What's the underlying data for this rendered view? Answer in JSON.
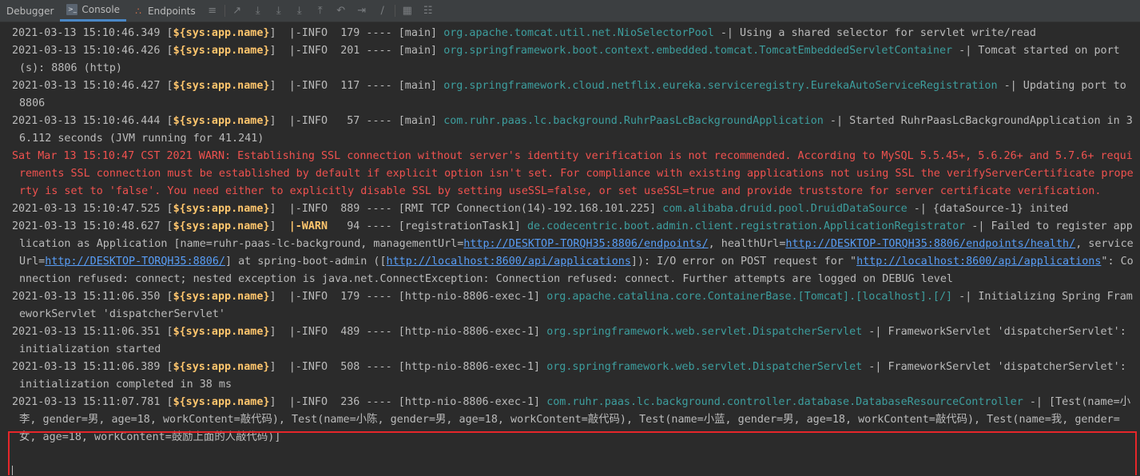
{
  "toolbar": {
    "tabs": [
      {
        "label": "Debugger"
      },
      {
        "label": "Console"
      },
      {
        "label": "Endpoints"
      }
    ]
  },
  "log": {
    "app_token": "${sys:app.name}",
    "lines": [
      {
        "ts": "2021-03-13 15:10:46.349",
        "level": "|-INFO ",
        "thread_id": "179",
        "thread": "[main]",
        "logger": "org.apache.tomcat.util.net.NioSelectorPool",
        "msg": "Using a shared selector for servlet write/read"
      },
      {
        "ts": "2021-03-13 15:10:46.426",
        "level": "|-INFO ",
        "thread_id": "201",
        "thread": "[main]",
        "logger": "org.springframework.boot.context.embedded.tomcat.TomcatEmbeddedServletContainer",
        "msg": "Tomcat started on port(s): 8806 (http)"
      },
      {
        "ts": "2021-03-13 15:10:46.427",
        "level": "|-INFO ",
        "thread_id": "117",
        "thread": "[main]",
        "logger": "org.springframework.cloud.netflix.eureka.serviceregistry.EurekaAutoServiceRegistration",
        "msg": "Updating port to 8806"
      },
      {
        "ts": "2021-03-13 15:10:46.444",
        "level": "|-INFO ",
        "thread_id": " 57",
        "thread": "[main]",
        "logger": "com.ruhr.paas.lc.background.RuhrPaasLcBackgroundApplication",
        "msg": "Started RuhrPaasLcBackgroundApplication in 36.112 seconds (JVM running for 41.241)"
      },
      {
        "ts": "2021-03-13 15:10:47.525",
        "level": "|-INFO ",
        "thread_id": "889",
        "thread": "[RMI TCP Connection(14)-192.168.101.225]",
        "logger": "com.alibaba.druid.pool.DruidDataSource",
        "msg": "{dataSource-1} inited"
      }
    ],
    "ssl_warning": "Sat Mar 13 15:10:47 CST 2021 WARN: Establishing SSL connection without server's identity verification is not recommended. According to MySQL 5.5.45+, 5.6.26+ and 5.7.6+ requirements SSL connection must be established by default if explicit option isn't set. For compliance with existing applications not using SSL the verifyServerCertificate property is set to 'false'. You need either to explicitly disable SSL by setting useSSL=false, or set useSSL=true and provide truststore for server certificate verification.",
    "warn_line": {
      "ts": "2021-03-13 15:10:48.627",
      "level": "|-WARN ",
      "thread_id": " 94",
      "thread": "[registrationTask1]",
      "logger": "de.codecentric.boot.admin.client.registration.ApplicationRegistrator",
      "msg1": "Failed to register application as Application [name=ruhr-paas-lc-background, managementUrl=",
      "url1": "http://DESKTOP-TORQH35:8806/endpoints/",
      "msg2": ", healthUrl=",
      "url2": "http://DESKTOP-TORQH35:8806/endpoints/health/",
      "msg3": ", serviceUrl=",
      "url3": "http://DESKTOP-TORQH35:8806/",
      "msg4": "] at spring-boot-admin ([",
      "url4": "http://localhost:8600/api/applications",
      "msg5": "]): I/O error on POST request for \"",
      "url5": "http://localhost:8600/api/applications",
      "msg6": "\": Connection refused: connect; nested exception is java.net.ConnectException: Connection refused: connect. Further attempts are logged on DEBUG level"
    },
    "lines2": [
      {
        "ts": "2021-03-13 15:11:06.350",
        "level": "|-INFO ",
        "thread_id": "179",
        "thread": "[http-nio-8806-exec-1]",
        "logger": "org.apache.catalina.core.ContainerBase.[Tomcat].[localhost].[/]",
        "msg": "Initializing Spring FrameworkServlet 'dispatcherServlet'"
      },
      {
        "ts": "2021-03-13 15:11:06.351",
        "level": "|-INFO ",
        "thread_id": "489",
        "thread": "[http-nio-8806-exec-1]",
        "logger": "org.springframework.web.servlet.DispatcherServlet",
        "msg": "FrameworkServlet 'dispatcherServlet': initialization started"
      },
      {
        "ts": "2021-03-13 15:11:06.389",
        "level": "|-INFO ",
        "thread_id": "508",
        "thread": "[http-nio-8806-exec-1]",
        "logger": "org.springframework.web.servlet.DispatcherServlet",
        "msg": "FrameworkServlet 'dispatcherServlet': initialization completed in 38 ms"
      },
      {
        "ts": "2021-03-13 15:11:07.781",
        "level": "|-INFO ",
        "thread_id": "236",
        "thread": "[http-nio-8806-exec-1]",
        "logger": "com.ruhr.paas.lc.background.controller.database.DatabaseResourceController",
        "msg": "[Test(name=小李, gender=男, age=18, workContent=敲代码), Test(name=小陈, gender=男, age=18, workContent=敲代码), Test(name=小蓝, gender=男, age=18, workContent=敲代码), Test(name=我, gender=女, age=18, workContent=鼓励上面的人敲代码)]"
      }
    ]
  }
}
